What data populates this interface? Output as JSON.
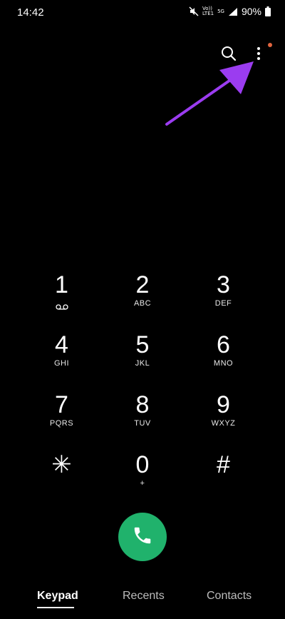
{
  "status_bar": {
    "time": "14:42",
    "volte_top": "Vo))",
    "volte_bottom": "LTE1",
    "network": "5G",
    "battery": "90%"
  },
  "toolbar": {
    "search_icon": "search-icon",
    "more_icon": "more-vertical-icon",
    "notification_dot_color": "#e2653f"
  },
  "annotation": {
    "arrow_color": "#9b3cf0"
  },
  "keypad": {
    "keys": [
      {
        "digit": "1",
        "letters": "",
        "sub_icon": "voicemail-icon"
      },
      {
        "digit": "2",
        "letters": "ABC"
      },
      {
        "digit": "3",
        "letters": "DEF"
      },
      {
        "digit": "4",
        "letters": "GHI"
      },
      {
        "digit": "5",
        "letters": "JKL"
      },
      {
        "digit": "6",
        "letters": "MNO"
      },
      {
        "digit": "7",
        "letters": "PQRS"
      },
      {
        "digit": "8",
        "letters": "TUV"
      },
      {
        "digit": "9",
        "letters": "WXYZ"
      },
      {
        "digit": "✳",
        "letters": ""
      },
      {
        "digit": "0",
        "letters": "+"
      },
      {
        "digit": "#",
        "letters": ""
      }
    ]
  },
  "call_button": {
    "icon": "phone-icon",
    "color": "#20b26c"
  },
  "tabs": [
    {
      "label": "Keypad",
      "active": true
    },
    {
      "label": "Recents",
      "active": false
    },
    {
      "label": "Contacts",
      "active": false
    }
  ]
}
